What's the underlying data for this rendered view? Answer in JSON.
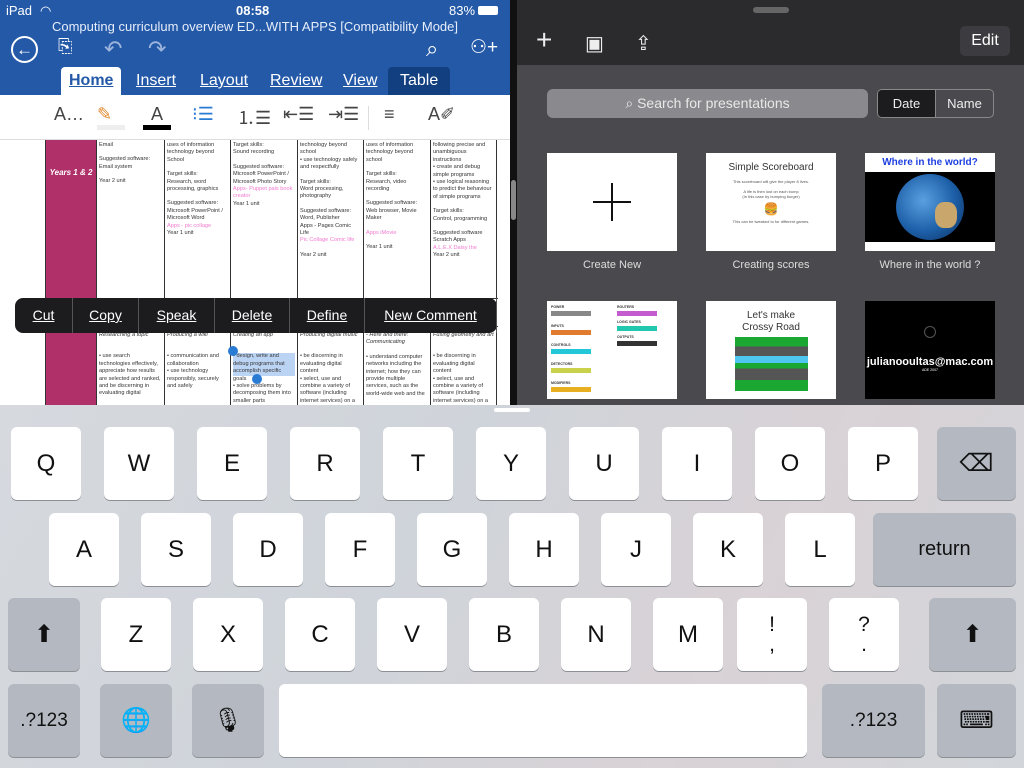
{
  "status_bar": {
    "device": "iPad",
    "time": "08:58",
    "battery": "83%"
  },
  "word": {
    "document_title": "Computing curriculum overview ED...WITH APPS [Compatibility Mode]",
    "header_icons": [
      "back-icon",
      "file-icon",
      "undo-icon",
      "redo-icon",
      "search-icon",
      "share-person-icon"
    ],
    "tabs": [
      "Home",
      "Insert",
      "Layout",
      "Review",
      "View",
      "Table"
    ],
    "active_tab": "Home",
    "toolbar": [
      "font-options-icon",
      "highlighter-icon",
      "font-color-icon",
      "bullets-icon",
      "numbering-icon",
      "decrease-indent-icon",
      "increase-indent-icon",
      "paragraph-options-icon",
      "styles-icon"
    ],
    "row_label": "Years 1 & 2",
    "row1": [
      [
        {
          "t": "Email"
        },
        {
          "t": ""
        },
        {
          "t": "Suggested software:"
        },
        {
          "t": "Email system"
        },
        {
          "t": ""
        },
        {
          "t": "Year 2 unit"
        }
      ],
      [
        {
          "t": "uses of information technology beyond School"
        },
        {
          "t": ""
        },
        {
          "t": "Target skills:"
        },
        {
          "t": "Research, word processing, graphics"
        },
        {
          "t": ""
        },
        {
          "t": "Suggested software:"
        },
        {
          "t": "Microsoft PowerPoint / Microsoft Word"
        },
        {
          "t": "Apps - pic collage",
          "c": "pink"
        },
        {
          "t": "Year 1 unit"
        }
      ],
      [
        {
          "t": "Target skills:"
        },
        {
          "t": "Sound recording"
        },
        {
          "t": ""
        },
        {
          "t": "Suggested software:"
        },
        {
          "t": "Microsoft PowerPoint / Microsoft Photo Story"
        },
        {
          "t": "Apps- Puppet pals book creator",
          "c": "pink"
        },
        {
          "t": "Year 1 unit"
        }
      ],
      [
        {
          "t": "technology beyond school"
        },
        {
          "t": "• use technology safely and respectfully"
        },
        {
          "t": ""
        },
        {
          "t": "Target skills:"
        },
        {
          "t": "Word processing, photography"
        },
        {
          "t": ""
        },
        {
          "t": "Suggested software:"
        },
        {
          "t": "Word, Publisher"
        },
        {
          "t": "Apps - Pages Comic Life"
        },
        {
          "t": "Pic Collage Comic life",
          "c": "pink"
        },
        {
          "t": ""
        },
        {
          "t": "Year 2 unit"
        }
      ],
      [
        {
          "t": "uses of information technology beyond school"
        },
        {
          "t": ""
        },
        {
          "t": "Target skills:"
        },
        {
          "t": "Research, video recording"
        },
        {
          "t": ""
        },
        {
          "t": "Suggested software:"
        },
        {
          "t": "Web browser, Movie Maker"
        },
        {
          "t": ""
        },
        {
          "t": "Apps iMovie",
          "c": "pink"
        },
        {
          "t": ""
        },
        {
          "t": "Year 1 unit"
        }
      ],
      [
        {
          "t": "following precise and unambiguous instructions"
        },
        {
          "t": "• create and debug simple programs"
        },
        {
          "t": "• use logical reasoning to predict the behaviour of simple programs"
        },
        {
          "t": ""
        },
        {
          "t": "Target skills:"
        },
        {
          "t": "Control, programming"
        },
        {
          "t": ""
        },
        {
          "t": "Suggested software"
        },
        {
          "t": "Scratch Apps"
        },
        {
          "t": "A.L.E.X Daisy the",
          "c": "pink"
        },
        {
          "t": "Year 2 unit"
        }
      ]
    ],
    "row2": [
      [
        {
          "t": "Researching a topic",
          "c": "it"
        },
        {
          "t": ""
        },
        {
          "t": ""
        },
        {
          "t": "• use search technologies effectively, appreciate how results are selected and ranked, and be discerning in evaluating digital"
        }
      ],
      [
        {
          "t": "Producing a wiki",
          "c": "it"
        },
        {
          "t": ""
        },
        {
          "t": ""
        },
        {
          "t": "• communication and collaboration"
        },
        {
          "t": "• use technology responsibly, securely and safely"
        }
      ],
      [
        {
          "t": "Creating an app",
          "c": "it"
        },
        {
          "t": ""
        },
        {
          "t": ""
        },
        {
          "t": "• design, write and debug programs that accomplish specific",
          "c": "sel"
        },
        {
          "t": "goals"
        },
        {
          "t": "• solve problems by decomposing them into smaller parts"
        }
      ],
      [
        {
          "t": "Producing digital music",
          "c": "it"
        },
        {
          "t": ""
        },
        {
          "t": ""
        },
        {
          "t": "• be discerning in evaluating digital content"
        },
        {
          "t": "• select, use and combine a variety of software (including internet services) on a range of digital devices to"
        }
      ],
      [
        {
          "t": "- Here and there: Communicating",
          "c": "it"
        },
        {
          "t": ""
        },
        {
          "t": "• understand computer networks including the internet; how they can provide multiple services, such as the world-wide web and the"
        }
      ],
      [
        {
          "t": "Fusing geometry and art",
          "c": "it"
        },
        {
          "t": ""
        },
        {
          "t": ""
        },
        {
          "t": "• be discerning in evaluating digital content"
        },
        {
          "t": "• select, use and combine a variety of software (including internet services) on a range of digital devices to"
        }
      ]
    ],
    "context_menu": [
      "Cut",
      "Copy",
      "Speak",
      "Delete",
      "Define",
      "New Comment"
    ],
    "accent": "#2459a8",
    "row_color": "#b0306a"
  },
  "keynote": {
    "top_icons": [
      "add-icon",
      "play-icon",
      "share-icon"
    ],
    "edit_label": "Edit",
    "search_placeholder": "Search for presentations",
    "sort": [
      "Date",
      "Name"
    ],
    "sort_selected": "Date",
    "items": [
      {
        "label": "Create New"
      },
      {
        "label": "Creating scores",
        "slide_title": "Simple Scoreboard",
        "slide_lines": [
          "This scoreboard will give the player 8 lives.",
          "A life is then lost on each bump",
          "(In this case by bumping burger)",
          "This can be tweaked to for different games."
        ]
      },
      {
        "label": "Where in the world ?",
        "slide_title": "Where in the world?"
      },
      {
        "label": "",
        "slide_lines": [
          "POWER",
          "INPUTS",
          "CONTROLS",
          "DETECTORS",
          "MODIFIERS",
          "ROUTERS",
          "LOGIC GATES",
          "OUTPUTS"
        ]
      },
      {
        "label": "",
        "slide_title": "Let's make Crossy Road"
      },
      {
        "label": "",
        "slide_title": "julianooultas@mac.com",
        "slide_lines": [
          "ADE 2007"
        ]
      }
    ]
  },
  "keyboard": {
    "row1": [
      "Q",
      "W",
      "E",
      "R",
      "T",
      "Y",
      "U",
      "I",
      "O",
      "P"
    ],
    "row2": [
      "A",
      "S",
      "D",
      "F",
      "G",
      "H",
      "J",
      "K",
      "L"
    ],
    "row3": [
      "Z",
      "X",
      "C",
      "V",
      "B",
      "N",
      "M"
    ],
    "punct": [
      [
        "!",
        ","
      ],
      [
        "?",
        "."
      ]
    ],
    "return_label": "return",
    "numbers_label": ".?123"
  }
}
